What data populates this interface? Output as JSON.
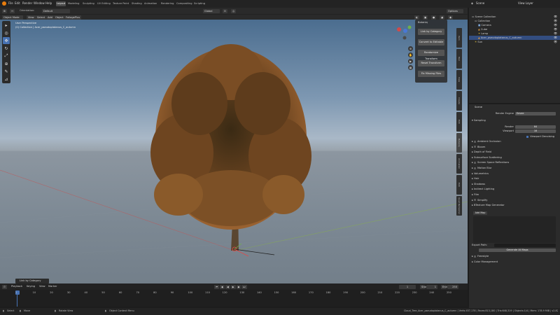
{
  "topbar": {
    "menus": [
      "File",
      "Edit",
      "Render",
      "Window",
      "Help"
    ],
    "workspaces": [
      "Layout",
      "Modeling",
      "Sculpting",
      "UV Editing",
      "Texture Paint",
      "Shading",
      "Animation",
      "Rendering",
      "Compositing",
      "Scripting"
    ],
    "active_workspace": "Layout",
    "scene_label": "Scene",
    "view_layer_label": "View Layer"
  },
  "viewport_header": {
    "mode": "Object Mode",
    "menus": [
      "View",
      "Select",
      "Add",
      "Object",
      "FoliagePlus"
    ],
    "orientation": "Orientation:",
    "orientation_value": "Default",
    "transform": "Global",
    "options": "Options"
  },
  "viewport": {
    "perspective": "User Perspective",
    "collection": "(0) Collection | Acer_pseudoplatanus_C_autumn"
  },
  "npanel": {
    "title": "Botaniq",
    "buttons": [
      "Link by Category",
      "Convert to Editable",
      "Randomize Transform",
      "Reset Transform",
      "Fix Missing Files"
    ]
  },
  "side_tabs": [
    "Item",
    "Tool",
    "View",
    "Create",
    "Edit",
    "Botaniq",
    "Animation",
    "Edit",
    "Quad Remesher"
  ],
  "outliner": {
    "rows": [
      {
        "label": "Scene Collection",
        "indent": 0
      },
      {
        "label": "Collection",
        "indent": 1
      },
      {
        "label": "Camera",
        "indent": 2
      },
      {
        "label": "Cube",
        "indent": 2
      },
      {
        "label": "Lamp",
        "indent": 2
      },
      {
        "label": "Acer_pseudoplatanus_C_autumn",
        "indent": 2,
        "selected": true
      },
      {
        "label": "Sun",
        "indent": 1
      }
    ]
  },
  "properties": {
    "title": "Scene",
    "render_engine_label": "Render Engine",
    "render_engine_value": "Eevee",
    "sampling": "Sampling",
    "render_label": "Render",
    "render_value": "64",
    "viewport_label": "Viewport",
    "viewport_value": "16",
    "viewport_denoising": "Viewport Denoising",
    "sections": [
      {
        "label": "Ambient Occlusion",
        "check": true
      },
      {
        "label": "Bloom",
        "check": true
      },
      {
        "label": "Depth of Field",
        "check": false
      },
      {
        "label": "Subsurface Scattering",
        "check": false
      },
      {
        "label": "Screen Space Reflections",
        "check": true
      },
      {
        "label": "Motion Blur",
        "check": true
      },
      {
        "label": "Volumetrics",
        "check": false
      },
      {
        "label": "Hair",
        "check": false
      },
      {
        "label": "Shadows",
        "check": false
      },
      {
        "label": "Indirect Lighting",
        "check": false
      },
      {
        "label": "Film",
        "check": false
      },
      {
        "label": "Simplify",
        "check": true
      },
      {
        "label": "BTexture Map Generator",
        "check": false
      }
    ],
    "add_map": "Add Map",
    "export_path_label": "Export Path:",
    "generate": "Generate All Maps",
    "freestyle": "Freestyle",
    "color_management": "Color Management"
  },
  "timeline": {
    "menus": [
      "Playback",
      "Keying",
      "View",
      "Marker"
    ],
    "current_frame": "1",
    "start_label": "Start",
    "start_value": "1",
    "end_label": "End",
    "end_value": "250",
    "ticks": [
      "1",
      "10",
      "20",
      "30",
      "40",
      "50",
      "60",
      "70",
      "80",
      "90",
      "100",
      "110",
      "120",
      "130",
      "140",
      "150",
      "160",
      "170",
      "180",
      "190",
      "200",
      "210",
      "220",
      "230",
      "240",
      "250"
    ]
  },
  "op_panel": "Link by Category",
  "statusbar": {
    "select": "Select",
    "move": "Move",
    "rotate": "Rotate View",
    "context": "Object Context Menu",
    "info": "Cloud_Tree_Acer_pseudoplatanus_C_autumn | Verts:457,178 | Faces:813,180 | Tris:648,319 | Objects:1/4 | Mem: 178.9 MiB | v2.82"
  },
  "colors": {
    "accent": "#4772b3",
    "selection": "#334d80",
    "foliage": "#7a4a1e"
  }
}
